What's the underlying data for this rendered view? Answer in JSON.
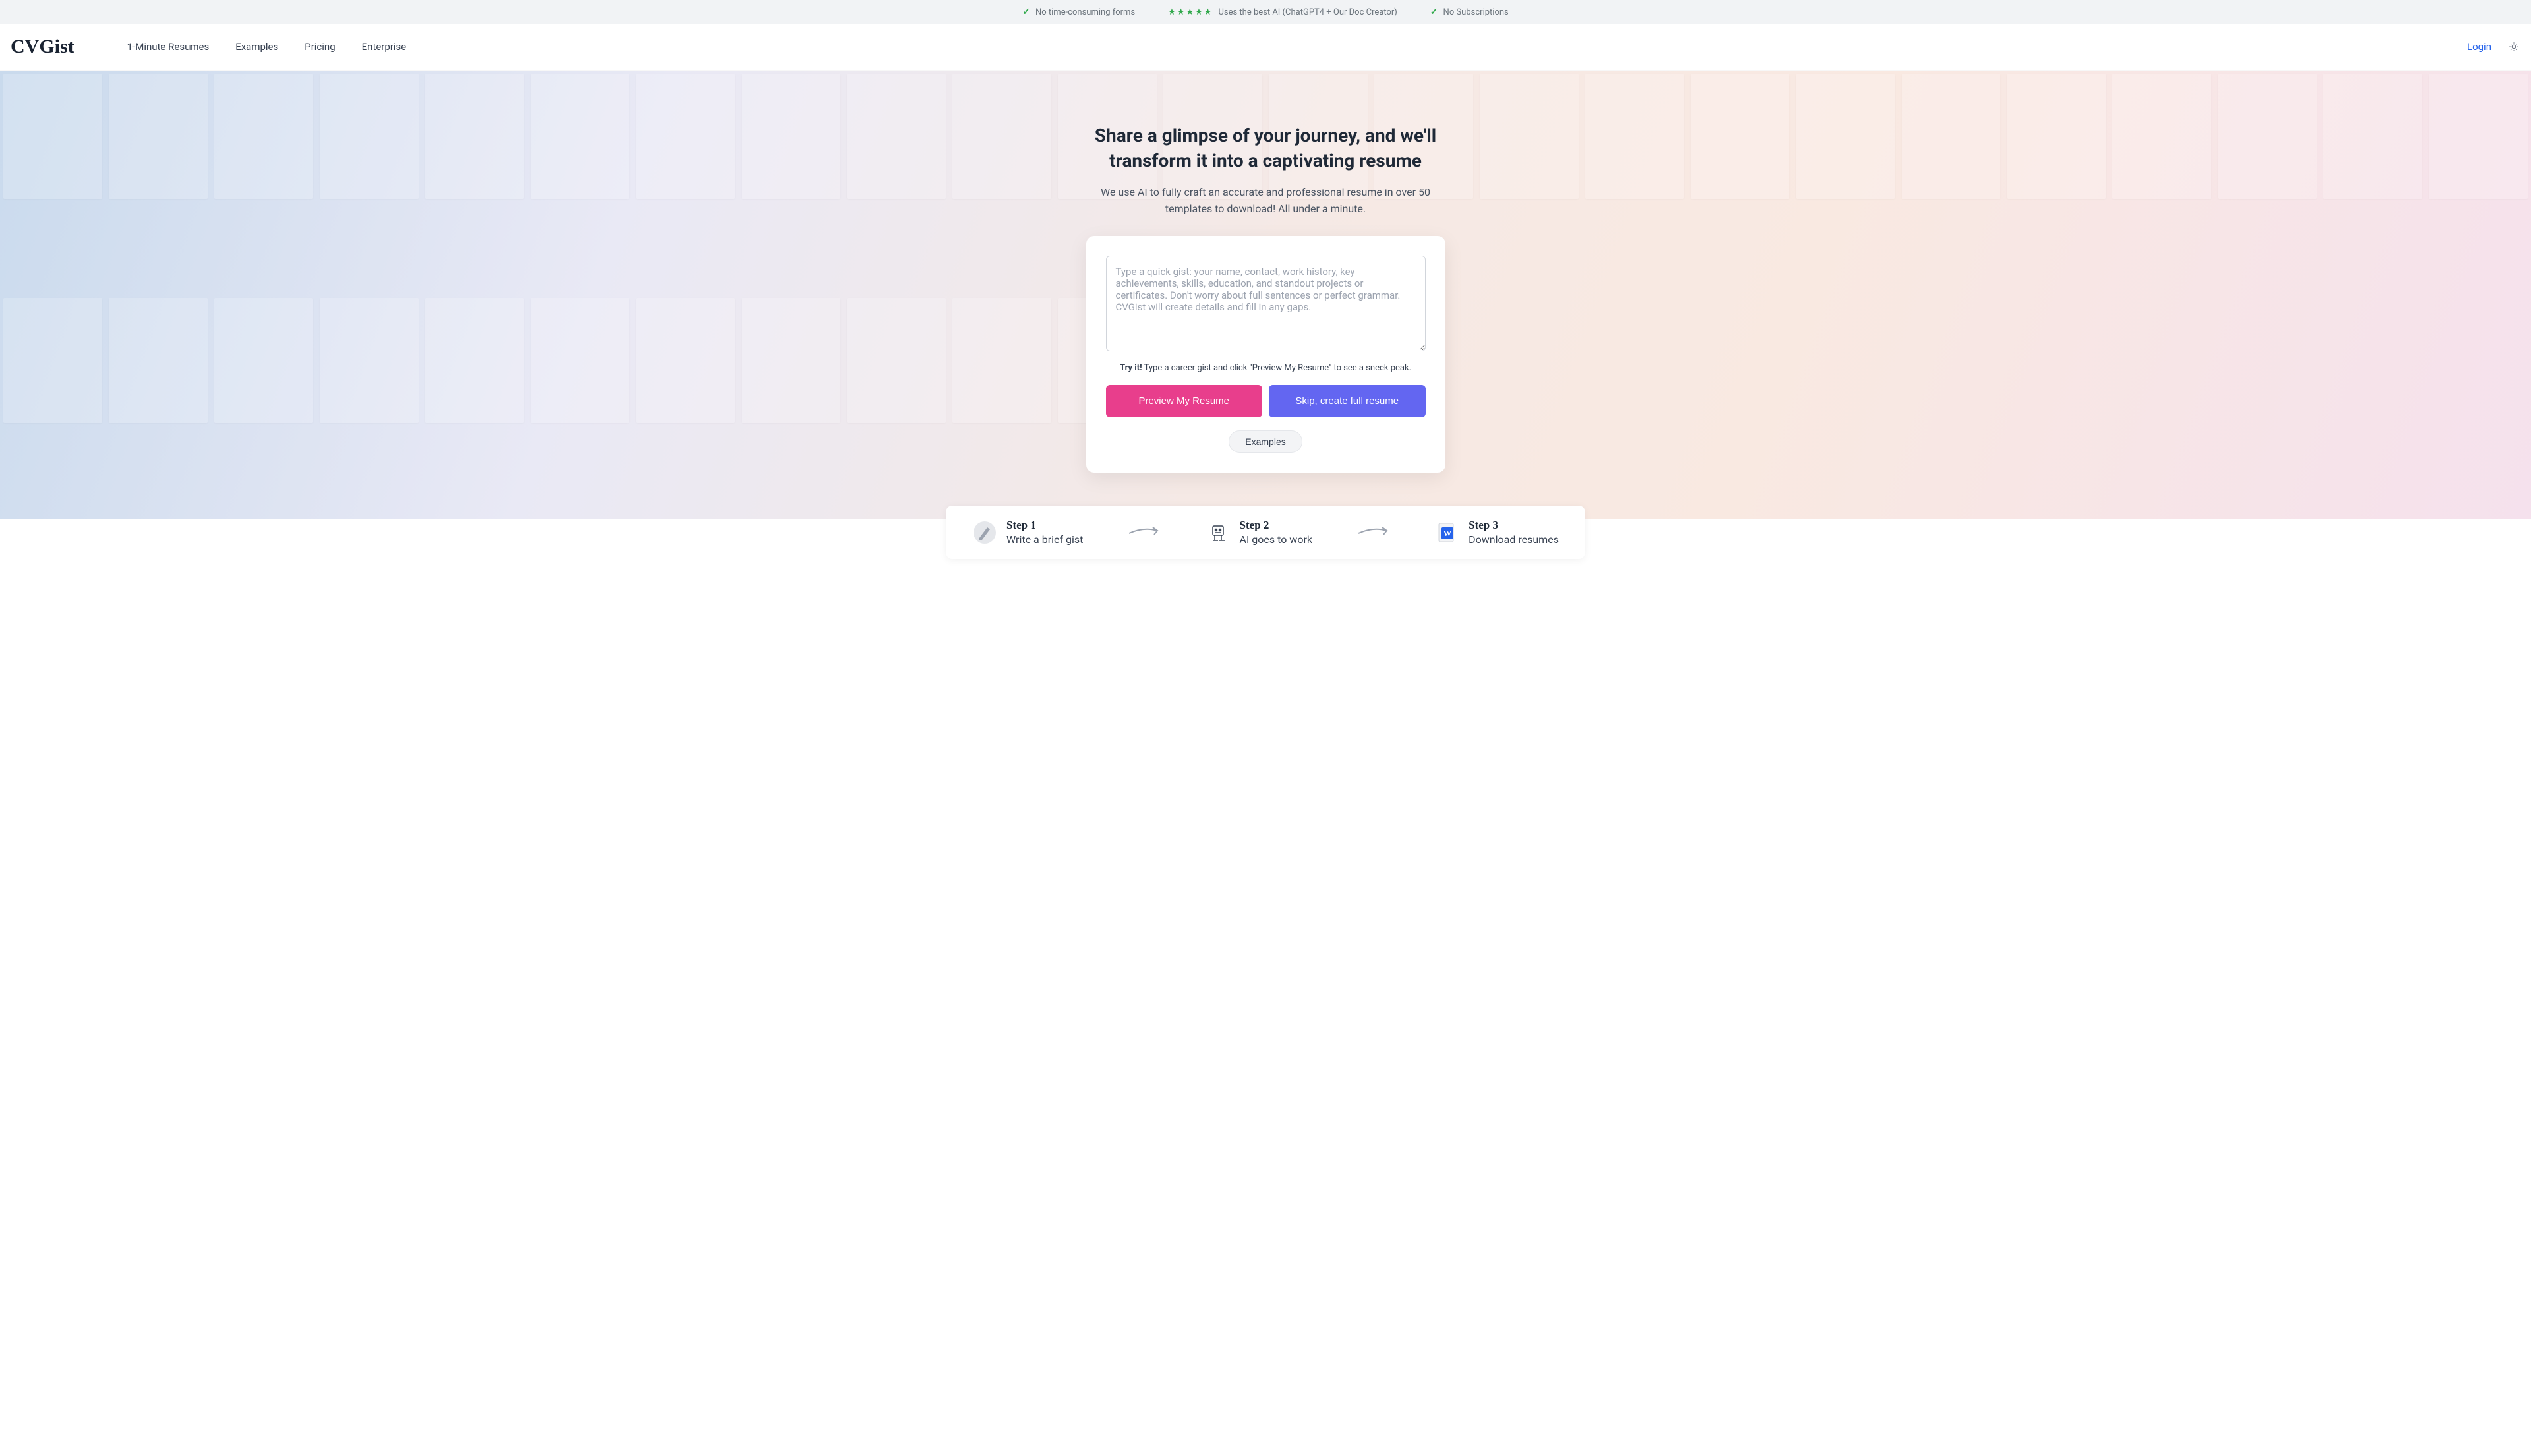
{
  "banner": {
    "item1": "No time-consuming forms",
    "item2": "Uses the best AI (ChatGPT4 + Our Doc Creator)",
    "item3": "No Subscriptions"
  },
  "nav": {
    "logo": "CVGist",
    "link1": "1-Minute Resumes",
    "link2": "Examples",
    "link3": "Pricing",
    "link4": "Enterprise",
    "login": "Login"
  },
  "hero": {
    "title": "Share a glimpse of your journey, and we'll transform it into a captivating resume",
    "subtitle": "We use AI to fully craft an accurate and professional resume in over 50 templates to download! All under a minute.",
    "placeholder": "Type a quick gist: your name, contact, work history, key achievements, skills, education, and standout projects or certificates. Don't worry about full sentences or perfect grammar. CVGist will create details and fill in any gaps.",
    "tryBold": "Try it!",
    "tryText": " Type a career gist and click \"Preview My Resume\" to see a sneek peak.",
    "btn1": "Preview My Resume",
    "btn2": "Skip, create full resume",
    "examplesBtn": "Examples"
  },
  "steps": {
    "s1title": "Step 1",
    "s1desc": "Write a brief gist",
    "s2title": "Step 2",
    "s2desc": "AI goes to work",
    "s3title": "Step 3",
    "s3desc": "Download resumes"
  }
}
